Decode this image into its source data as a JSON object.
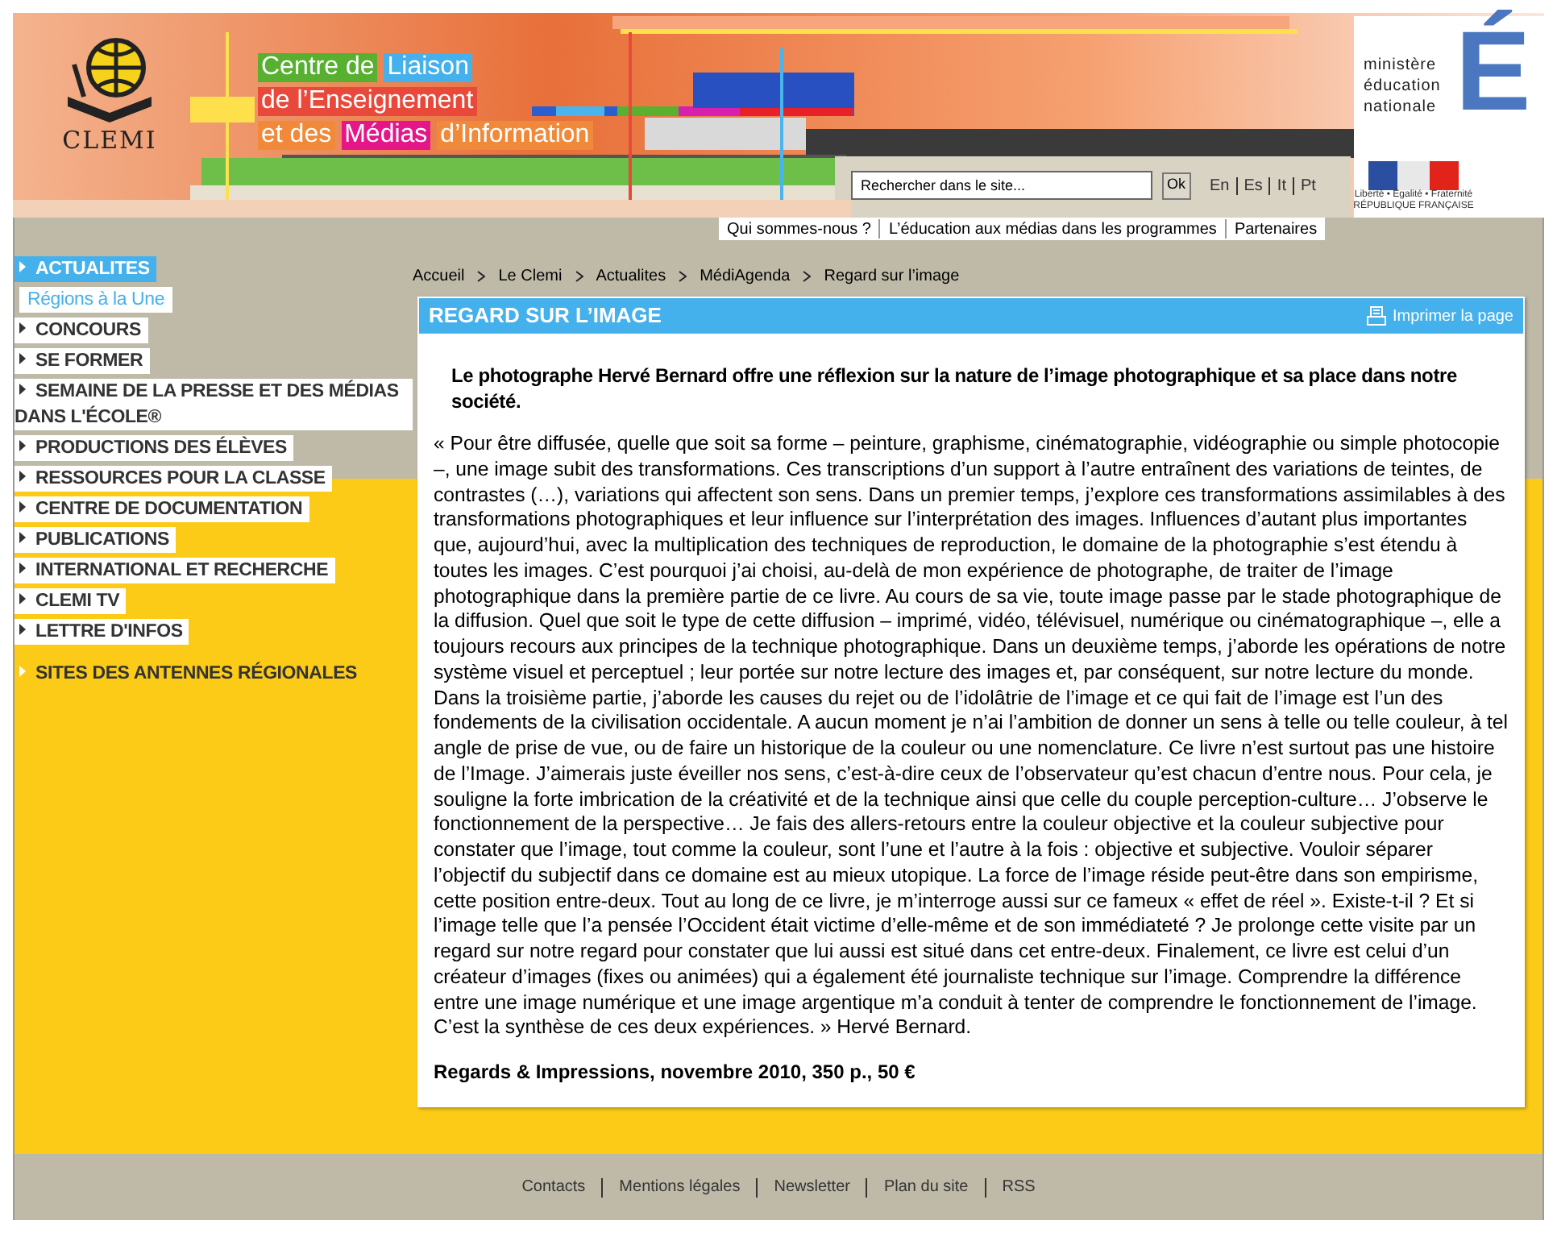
{
  "header": {
    "logo_text": "CLEMI",
    "title_lines": [
      {
        "segments": [
          {
            "text": "Centre de",
            "color": "#58b030"
          },
          {
            "text": "Liaison",
            "color": "#45b1ec"
          }
        ]
      },
      {
        "segments": [
          {
            "text": "de l’Enseignement",
            "color": "#e8493a"
          }
        ]
      },
      {
        "segments": [
          {
            "text": "et des",
            "color": "#f08a3a"
          },
          {
            "text": "Médias",
            "color": "#e4168a"
          },
          {
            "text": "d’Information",
            "color": "#f08a3a"
          }
        ]
      }
    ],
    "ministry_lines": [
      "ministère",
      "éducation",
      "nationale"
    ],
    "ministry_letter": "É",
    "republic_motto": "Liberté • Égalité • Fraternité",
    "republic_name": "RÉPUBLIQUE FRANÇAISE",
    "search": {
      "placeholder": "Rechercher dans le site..."
    },
    "search_button": "Ok",
    "languages": [
      "En",
      "Es",
      "It",
      "Pt"
    ],
    "top_links": [
      "Qui sommes-nous ?",
      "L’éducation aux médias dans les programmes",
      "Partenaires"
    ]
  },
  "nav": [
    {
      "label": "ACTUALITES",
      "kind": "section",
      "selected": true
    },
    {
      "label": "Régions à la Une",
      "kind": "sub",
      "selected": false
    },
    {
      "label": "CONCOURS",
      "kind": "section",
      "selected": false
    },
    {
      "label": "SE FORMER",
      "kind": "section",
      "selected": false
    },
    {
      "label": "SEMAINE DE LA PRESSE ET DES MÉDIAS DANS L'ÉCOLE®",
      "kind": "section",
      "selected": false
    },
    {
      "label": "PRODUCTIONS DES ÉLÈVES",
      "kind": "section",
      "selected": false
    },
    {
      "label": "RESSOURCES POUR LA CLASSE",
      "kind": "section",
      "selected": false
    },
    {
      "label": "CENTRE DE DOCUMENTATION",
      "kind": "section",
      "selected": false
    },
    {
      "label": "PUBLICATIONS",
      "kind": "section",
      "selected": false
    },
    {
      "label": "INTERNATIONAL ET RECHERCHE",
      "kind": "section",
      "selected": false
    },
    {
      "label": "CLEMI TV",
      "kind": "section",
      "selected": false
    },
    {
      "label": "LETTRE D'INFOS",
      "kind": "section",
      "selected": false
    },
    {
      "label": "SITES DES ANTENNES RÉGIONALES",
      "kind": "special",
      "selected": false
    }
  ],
  "breadcrumb": [
    "Accueil",
    "Le Clemi",
    "Actualites",
    "MédiAgenda",
    "Regard sur l’image"
  ],
  "article": {
    "title": "REGARD SUR L’IMAGE",
    "print_link": "Imprimer la page",
    "lead": "Le photographe Hervé Bernard offre une réflexion sur la nature de l’image photographique et sa place dans notre société.",
    "body": "« Pour être diffusée, quelle que soit sa forme – peinture, graphisme, cinématographie, vidéographie ou simple photocopie –, une image subit des transformations. Ces transcriptions d’un support à l’autre entraînent des variations de teintes, de contrastes (…), variations qui affectent son sens. Dans un premier temps, j’explore ces transformations assimilables à des transformations photographiques et leur influence sur l’interprétation des images. Influences d’autant plus importantes que, aujourd’hui, avec la multiplication des techniques de reproduction, le domaine de la photographie s’est étendu à toutes les images. C’est pourquoi j’ai choisi, au-delà de mon expérience de photographe, de traiter de l’image photographique dans la première partie de ce livre. Au cours de sa vie, toute image passe par le stade photographique de la diffusion. Quel que soit le type de cette diffusion – imprimé, vidéo, télévisuel, numérique ou cinématographique –, elle a toujours recours aux principes de la technique photographique. Dans un deuxième temps, j’aborde les opérations de notre système visuel et perceptuel ; leur portée sur notre lecture des images et, par conséquent, sur notre lecture du monde. Dans la troisième partie, j’aborde les causes du rejet ou de l’idolâtrie de l’image et ce qui fait de l’image est l’un des fondements de la civilisation occidentale. A aucun moment je n’ai l’ambition de donner un sens à telle ou telle couleur, à tel angle de prise de vue, ou de faire un historique de la couleur ou une nomenclature. Ce livre n’est surtout pas une histoire de l’Image. J’aimerais juste éveiller nos sens, c’est-à-dire ceux de l’observateur qu’est chacun d’entre nous. Pour cela, je souligne la forte imbrication de la créativité et de la technique ainsi que celle du couple perception-culture… J’observe le fonctionnement de la perspective… Je fais des allers-retours entre la couleur objective et la couleur subjective pour constater que l’image, tout comme la couleur, sont l’une et l’autre à la fois : objective et subjective. Vouloir séparer l’objectif du subjectif dans ce domaine est au mieux utopique. La force de l’image réside peut-être dans son empirisme, cette position entre-deux. Tout au long de ce livre, je m’interroge aussi sur ce fameux « effet de réel ». Existe-t-il ? Et si l’image telle que l’a pensée l’Occident était victime d’elle-même et de son immédiateté ? Je prolonge cette visite par un regard sur notre regard pour constater que lui aussi est situé dans cet entre-deux. Finalement, ce livre est celui d’un créateur d’images (fixes ou animées) qui a également été journaliste technique sur l’image. Comprendre la différence entre une image numérique et une image argentique m’a conduit à tenter de comprendre le fonctionnement de l’image. C’est la synthèse de ces deux expériences. » Hervé Bernard.",
    "reference": "Regards & Impressions, novembre 2010, 350 p., 50 €"
  },
  "footer_links": [
    "Contacts",
    "Mentions légales",
    "Newsletter",
    "Plan du site",
    "RSS"
  ]
}
